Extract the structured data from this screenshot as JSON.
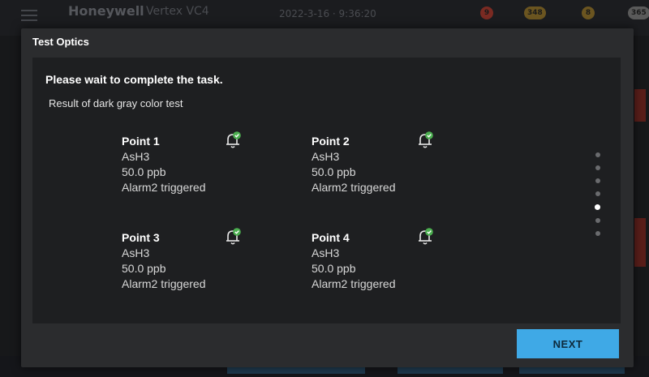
{
  "background": {
    "brand": "Honeywell",
    "product": "Vertex VC4",
    "datetime": "2022-3-16 · 9:36:20",
    "badges": [
      {
        "icon": "alarm-bell-icon",
        "count": "9",
        "color": "#e24b3b"
      },
      {
        "icon": "fault-icon",
        "count": "348",
        "color": "#f2b233"
      },
      {
        "icon": "maintenance-icon",
        "count": "8",
        "color": "#f2b233"
      },
      {
        "icon": "list-icon",
        "count": "365",
        "color": "#cfcfcf"
      }
    ]
  },
  "dialog": {
    "title": "Test Optics",
    "instruction": "Please wait to complete the task.",
    "subtitle": "Result of dark gray color test",
    "points": [
      {
        "name": "Point 1",
        "gas": "AsH3",
        "reading": "50.0 ppb",
        "status": "Alarm2 triggered"
      },
      {
        "name": "Point 2",
        "gas": "AsH3",
        "reading": "50.0 ppb",
        "status": "Alarm2 triggered"
      },
      {
        "name": "Point 3",
        "gas": "AsH3",
        "reading": "50.0 ppb",
        "status": "Alarm2 triggered"
      },
      {
        "name": "Point 4",
        "gas": "AsH3",
        "reading": "50.0 ppb",
        "status": "Alarm2 triggered"
      }
    ],
    "pagination": {
      "total": 7,
      "current": 5
    },
    "next_label": "NEXT"
  },
  "colors": {
    "accent": "#3fa9e6",
    "check": "#4caf50",
    "dialog_bg": "#2b2c2e",
    "content_bg": "#1e1f21"
  }
}
